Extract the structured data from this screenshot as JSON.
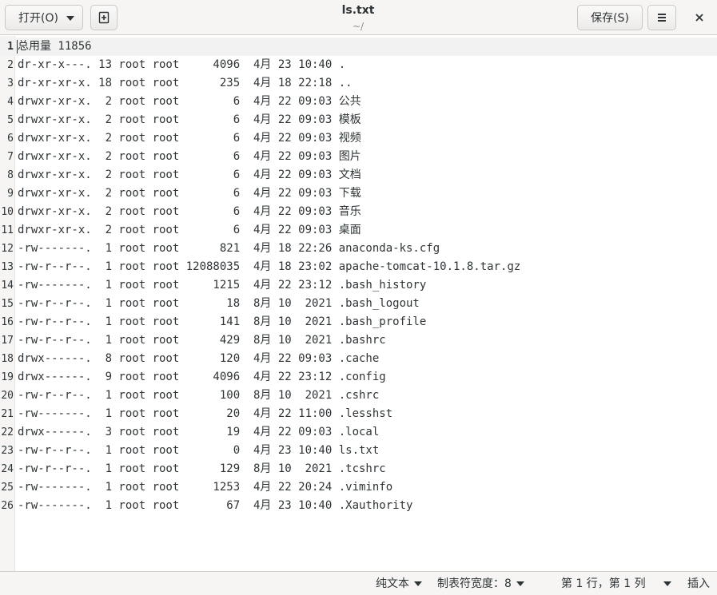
{
  "header": {
    "open_label": "打开(O)",
    "save_label": "保存(S)",
    "title": "ls.txt",
    "subtitle": "~/"
  },
  "editor": {
    "lines": [
      {
        "n": "1",
        "text": "总用量 11856"
      },
      {
        "n": "2",
        "text": "dr-xr-x---. 13 root root     4096  4月 23 10:40 ."
      },
      {
        "n": "3",
        "text": "dr-xr-xr-x. 18 root root      235  4月 18 22:18 .."
      },
      {
        "n": "4",
        "text": "drwxr-xr-x.  2 root root        6  4月 22 09:03 公共"
      },
      {
        "n": "5",
        "text": "drwxr-xr-x.  2 root root        6  4月 22 09:03 模板"
      },
      {
        "n": "6",
        "text": "drwxr-xr-x.  2 root root        6  4月 22 09:03 视频"
      },
      {
        "n": "7",
        "text": "drwxr-xr-x.  2 root root        6  4月 22 09:03 图片"
      },
      {
        "n": "8",
        "text": "drwxr-xr-x.  2 root root        6  4月 22 09:03 文档"
      },
      {
        "n": "9",
        "text": "drwxr-xr-x.  2 root root        6  4月 22 09:03 下载"
      },
      {
        "n": "10",
        "text": "drwxr-xr-x.  2 root root        6  4月 22 09:03 音乐"
      },
      {
        "n": "11",
        "text": "drwxr-xr-x.  2 root root        6  4月 22 09:03 桌面"
      },
      {
        "n": "12",
        "text": "-rw-------.  1 root root      821  4月 18 22:26 anaconda-ks.cfg"
      },
      {
        "n": "13",
        "text": "-rw-r--r--.  1 root root 12088035  4月 18 23:02 apache-tomcat-10.1.8.tar.gz"
      },
      {
        "n": "14",
        "text": "-rw-------.  1 root root     1215  4月 22 23:12 .bash_history"
      },
      {
        "n": "15",
        "text": "-rw-r--r--.  1 root root       18  8月 10  2021 .bash_logout"
      },
      {
        "n": "16",
        "text": "-rw-r--r--.  1 root root      141  8月 10  2021 .bash_profile"
      },
      {
        "n": "17",
        "text": "-rw-r--r--.  1 root root      429  8月 10  2021 .bashrc"
      },
      {
        "n": "18",
        "text": "drwx------.  8 root root      120  4月 22 09:03 .cache"
      },
      {
        "n": "19",
        "text": "drwx------.  9 root root     4096  4月 22 23:12 .config"
      },
      {
        "n": "20",
        "text": "-rw-r--r--.  1 root root      100  8月 10  2021 .cshrc"
      },
      {
        "n": "21",
        "text": "-rw-------.  1 root root       20  4月 22 11:00 .lesshst"
      },
      {
        "n": "22",
        "text": "drwx------.  3 root root       19  4月 22 09:03 .local"
      },
      {
        "n": "23",
        "text": "-rw-r--r--.  1 root root        0  4月 23 10:40 ls.txt"
      },
      {
        "n": "24",
        "text": "-rw-r--r--.  1 root root      129  8月 10  2021 .tcshrc"
      },
      {
        "n": "25",
        "text": "-rw-------.  1 root root     1253  4月 22 20:24 .viminfo"
      },
      {
        "n": "26",
        "text": "-rw-------.  1 root root       67  4月 23 10:40 .Xauthority"
      }
    ]
  },
  "status": {
    "syntax": "纯文本",
    "tab_width": "制表符宽度：8",
    "position": "第 1 行，第 1 列",
    "mode": "插入"
  }
}
